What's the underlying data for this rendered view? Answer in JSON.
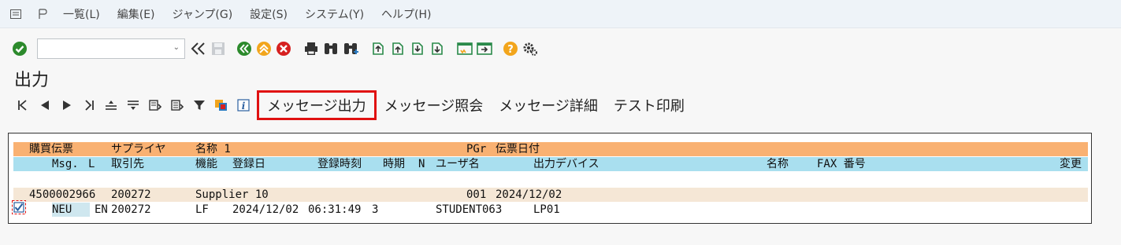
{
  "menubar": {
    "items": [
      "一覧(L)",
      "編集(E)",
      "ジャンプ(G)",
      "設定(S)",
      "システム(Y)",
      "ヘルプ(H)"
    ]
  },
  "toolbar": {
    "command_field_value": ""
  },
  "page": {
    "title": "出力"
  },
  "app_toolbar": {
    "text_buttons": [
      "メッセージ出力",
      "メッセージ照会",
      "メッセージ詳細",
      "テスト印刷"
    ]
  },
  "list": {
    "header1": {
      "po_number": "購買伝票",
      "supplier": "サプライヤ",
      "name1": "名称 1",
      "pgr": "PGr",
      "doc_date": "伝票日付"
    },
    "header2": {
      "msg": "Msg.",
      "lang": "L",
      "partner": "取引先",
      "function": "機能",
      "created_date": "登録日",
      "created_time": "登録時刻",
      "timing": "時期",
      "medium": "N",
      "user": "ユーザ名",
      "device": "出力デバイス",
      "name": "名称",
      "fax": "FAX 番号",
      "change": "変更"
    },
    "doc_row": {
      "po_number": "4500002966",
      "supplier": "200272",
      "name1": "Supplier 10",
      "pgr": "001",
      "doc_date": "2024/12/02"
    },
    "msg_row": {
      "status": "NEU",
      "lang": "EN",
      "partner": "200272",
      "function": "LF",
      "created_date": "2024/12/02",
      "created_time": "06:31:49",
      "timing": "3",
      "user": "STUDENT063",
      "device": "LP01",
      "selected": true
    }
  },
  "colors": {
    "header1_bg": "#f9b172",
    "header2_bg": "#a9dfef",
    "doc_row_bg": "#f5e7d6",
    "highlight_border": "#e01010"
  }
}
